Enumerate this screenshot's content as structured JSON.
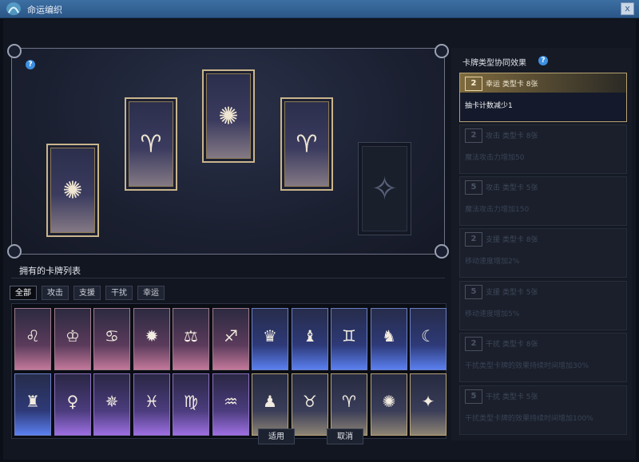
{
  "window": {
    "title": "命运编织",
    "close_glyph": "x"
  },
  "board": {
    "help": "?"
  },
  "deck_cards": [
    {
      "symbol": "✺",
      "state": "filled"
    },
    {
      "symbol": "♈",
      "state": "filled"
    },
    {
      "symbol": "✺",
      "state": "filled"
    },
    {
      "symbol": "♈",
      "state": "filled"
    },
    {
      "symbol": "✧",
      "state": "empty"
    }
  ],
  "collection": {
    "title": "拥有的卡牌列表",
    "tabs": [
      "全部",
      "攻击",
      "支援",
      "干扰",
      "幸运"
    ],
    "active_tab": "全部",
    "cards": [
      {
        "symbol": "♌",
        "color": "red"
      },
      {
        "symbol": "♔",
        "color": "red"
      },
      {
        "symbol": "♋",
        "color": "red"
      },
      {
        "symbol": "✹",
        "color": "red"
      },
      {
        "symbol": "⚖",
        "color": "red"
      },
      {
        "symbol": "♐",
        "color": "red"
      },
      {
        "symbol": "♛",
        "color": "blue"
      },
      {
        "symbol": "♝",
        "color": "blue"
      },
      {
        "symbol": "♊",
        "color": "blue"
      },
      {
        "symbol": "♞",
        "color": "blue"
      },
      {
        "symbol": "☾",
        "color": "blue"
      },
      {
        "symbol": "♜",
        "color": "blue"
      },
      {
        "symbol": "♀",
        "color": "purple"
      },
      {
        "symbol": "✵",
        "color": "purple"
      },
      {
        "symbol": "♓",
        "color": "purple"
      },
      {
        "symbol": "♍",
        "color": "purple"
      },
      {
        "symbol": "♒",
        "color": "purple"
      },
      {
        "symbol": "♟",
        "color": "gold"
      },
      {
        "symbol": "♉",
        "color": "gold"
      },
      {
        "symbol": "♈",
        "color": "gold"
      },
      {
        "symbol": "✺",
        "color": "gold"
      },
      {
        "symbol": "✦",
        "color": "gold"
      }
    ]
  },
  "buttons": {
    "apply": "适用",
    "cancel": "取消"
  },
  "synergy": {
    "title": "卡牌类型协同效果",
    "help": "?",
    "items": [
      {
        "badge": "2",
        "name": "幸运 类型卡 8张",
        "desc": "抽卡计数减少1",
        "active": true
      },
      {
        "badge": "2",
        "name": "攻击 类型卡 8张",
        "desc": "魔法攻击力增加50",
        "active": false
      },
      {
        "badge": "5",
        "name": "攻击 类型卡 5张",
        "desc": "魔法攻击力增加150",
        "active": false
      },
      {
        "badge": "2",
        "name": "支援 类型卡 8张",
        "desc": "移动速度增加2%",
        "active": false
      },
      {
        "badge": "5",
        "name": "支援 类型卡 5张",
        "desc": "移动速度增加5%",
        "active": false
      },
      {
        "badge": "2",
        "name": "干扰 类型卡 8张",
        "desc": "干扰类型卡牌的效果持续时间增加30%",
        "active": false
      },
      {
        "badge": "5",
        "name": "干扰 类型卡 5张",
        "desc": "干扰类型卡牌的效果持续时间增加100%",
        "active": false
      }
    ]
  }
}
